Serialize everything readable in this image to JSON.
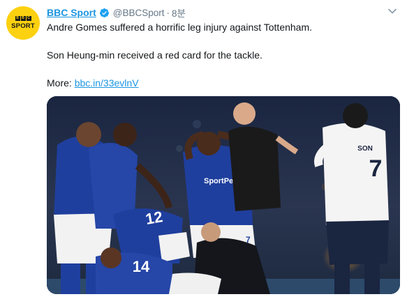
{
  "tweet": {
    "avatar_top": "BBC",
    "avatar_bottom": "SPORT",
    "display_name": "BBC Sport",
    "handle": "@BBCSport",
    "separator": "·",
    "time": "8분",
    "line1": "Andre Gomes suffered a horrific leg injury against Tottenham.",
    "line2": "Son Heung-min received a red card for the tackle.",
    "line3_prefix": "More: ",
    "link_text": "bbc.in/33evlnV",
    "photo": {
      "jersey_back_name": "SON",
      "jersey_back_number": "7",
      "jersey_numbers": [
        "12",
        "14",
        "7"
      ],
      "sponsor": "SportPesa"
    }
  },
  "colors": {
    "link": "#1b95e0",
    "secondary_text": "#657786",
    "avatar_bg": "#fcd10f",
    "everton_blue": "#1f3f9e",
    "tottenham_white": "#f4f4f4"
  },
  "icons": {
    "verified": "verified-badge-icon",
    "caret": "chevron-down-icon"
  }
}
